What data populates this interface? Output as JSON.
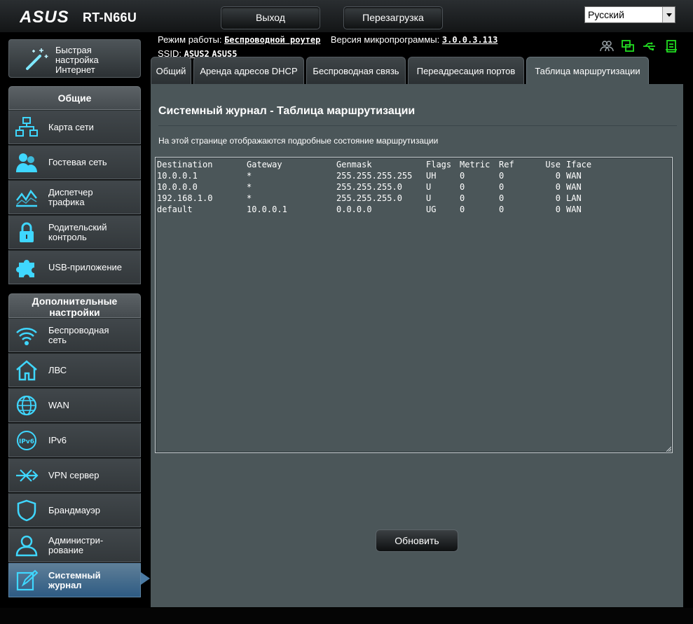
{
  "header": {
    "model": "RT-N66U",
    "logout_label": "Выход",
    "reboot_label": "Перезагрузка",
    "language": "Русский"
  },
  "info": {
    "mode_label": "Режим работы:",
    "mode_value": "Беспроводной роутер",
    "firmware_label": "Версия микропрограммы:",
    "firmware_value": "3.0.0.3.113",
    "ssid_label": "SSID:",
    "ssid_1": "ASUS2",
    "ssid_2": "ASUS5"
  },
  "status_icons": [
    "clients-icon",
    "network-status-icon",
    "usb-icon",
    "printer-icon"
  ],
  "sidebar": {
    "quick": {
      "line1": "Быстрая",
      "line2": "настройка",
      "line3": "Интернет"
    },
    "general_header": "Общие",
    "general": [
      {
        "line1": "Карта сети",
        "line2": "",
        "icon": "network-map-icon"
      },
      {
        "line1": "Гостевая сеть",
        "line2": "",
        "icon": "guest-network-icon"
      },
      {
        "line1": "Диспетчер",
        "line2": "трафика",
        "icon": "traffic-manager-icon"
      },
      {
        "line1": "Родительский",
        "line2": "контроль",
        "icon": "parental-control-icon"
      },
      {
        "line1": "USB-приложение",
        "line2": "",
        "icon": "usb-application-icon"
      }
    ],
    "advanced_header_1": "Дополнительные",
    "advanced_header_2": "настройки",
    "advanced": [
      {
        "line1": "Беспроводная",
        "line2": "сеть",
        "icon": "wireless-icon"
      },
      {
        "line1": "ЛВС",
        "line2": "",
        "icon": "lan-icon"
      },
      {
        "line1": "WAN",
        "line2": "",
        "icon": "wan-icon"
      },
      {
        "line1": "IPv6",
        "line2": "",
        "icon": "ipv6-icon"
      },
      {
        "line1": "VPN сервер",
        "line2": "",
        "icon": "vpn-icon"
      },
      {
        "line1": "Брандмауэр",
        "line2": "",
        "icon": "firewall-icon"
      },
      {
        "line1": "Администри-",
        "line2": "рование",
        "icon": "administration-icon"
      },
      {
        "line1": "Системный",
        "line2": "журнал",
        "icon": "system-log-icon"
      }
    ]
  },
  "tabs": [
    "Общий",
    "Аренда адресов DHCP",
    "Беспроводная связь",
    "Переадресация портов",
    "Таблица маршрутизации"
  ],
  "active_tab": "Таблица маршрутизации",
  "main": {
    "title": "Системный журнал - Таблица маршрутизации",
    "description": "На этой странице отображаются подробные состояние маршрутизации",
    "refresh_label": "Обновить"
  },
  "routes": {
    "headers": [
      "Destination",
      "Gateway",
      "Genmask",
      "Flags",
      "Metric",
      "Ref",
      "Use",
      "Iface"
    ],
    "rows": [
      [
        "10.0.0.1",
        "*",
        "255.255.255.255",
        "UH",
        "0",
        "0",
        "0",
        "WAN"
      ],
      [
        "10.0.0.0",
        "*",
        "255.255.255.0",
        "U",
        "0",
        "0",
        "0",
        "WAN"
      ],
      [
        "192.168.1.0",
        "*",
        "255.255.255.0",
        "U",
        "0",
        "0",
        "0",
        "LAN"
      ],
      [
        "default",
        "10.0.0.1",
        "0.0.0.0",
        "UG",
        "0",
        "0",
        "0",
        "WAN"
      ]
    ]
  },
  "colors": {
    "accent": "#00e0ff",
    "active_nav": "#2e5b83",
    "panel": "#4b5659"
  }
}
